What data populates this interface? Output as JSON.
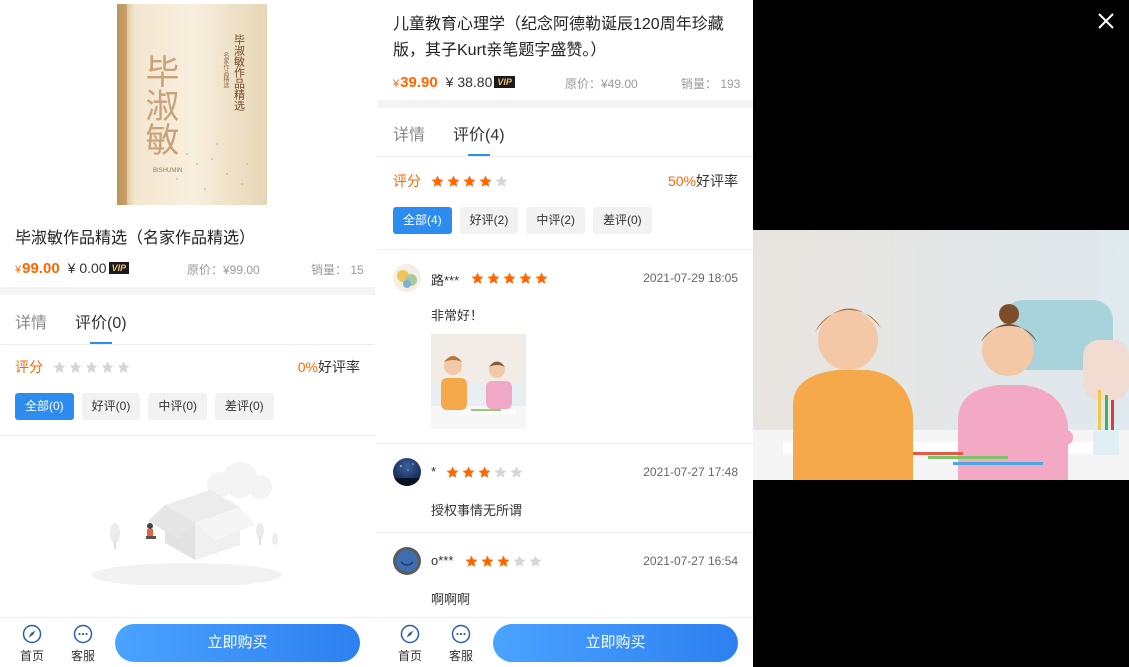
{
  "left": {
    "cover": {
      "title_big": "毕淑敏",
      "title_small": "毕淑敏作品精选",
      "subtitle": "名家作品精选",
      "pinyin": "BISHUMIN"
    },
    "title": "毕淑敏作品精选（名家作品精选）",
    "price": "99.00",
    "currency": "¥",
    "vip_price": "¥ 0.00",
    "vip_tag": "VIP",
    "original_price": "原价：¥99.00",
    "sales": "销量： 15",
    "tabs": [
      "详情",
      "评价(0)"
    ],
    "rating_label": "评分",
    "good_rate_pct": "0%",
    "good_rate_suffix": "好评率",
    "stars_filled": 0,
    "filters": [
      "全部(0)",
      "好评(0)",
      "中评(0)",
      "差评(0)"
    ]
  },
  "right": {
    "title": "儿童教育心理学（纪念阿德勒诞辰120周年珍藏版，其子Kurt亲笔题字盛赞。）",
    "price": "39.90",
    "currency": "¥",
    "vip_price": "¥ 38.80",
    "vip_tag": "VIP",
    "original_price": "原价：¥49.00",
    "sales": "销量： 193",
    "tabs": [
      "详情",
      "评价(4)"
    ],
    "rating_label": "评分",
    "good_rate_pct": "50%",
    "good_rate_suffix": "好评率",
    "stars_filled": 4,
    "filters": [
      "全部(4)",
      "好评(2)",
      "中评(2)",
      "差评(0)"
    ],
    "reviews": [
      {
        "name": "路***",
        "stars": 5,
        "date": "2021-07-29 18:05",
        "text": "非常好！"
      },
      {
        "name": "*",
        "stars": 3,
        "date": "2021-07-27 17:48",
        "text": "授权事情无所谓"
      },
      {
        "name": "o***",
        "stars": 3,
        "date": "2021-07-27 16:54",
        "text": "啊啊啊"
      }
    ]
  },
  "bottom": {
    "home": "首页",
    "service": "客服",
    "buy": "立即购买"
  },
  "colors": {
    "accent": "#2d8cf0",
    "price": "#ff6600",
    "star": "#ff6600",
    "star_empty": "#d6d6d6"
  }
}
